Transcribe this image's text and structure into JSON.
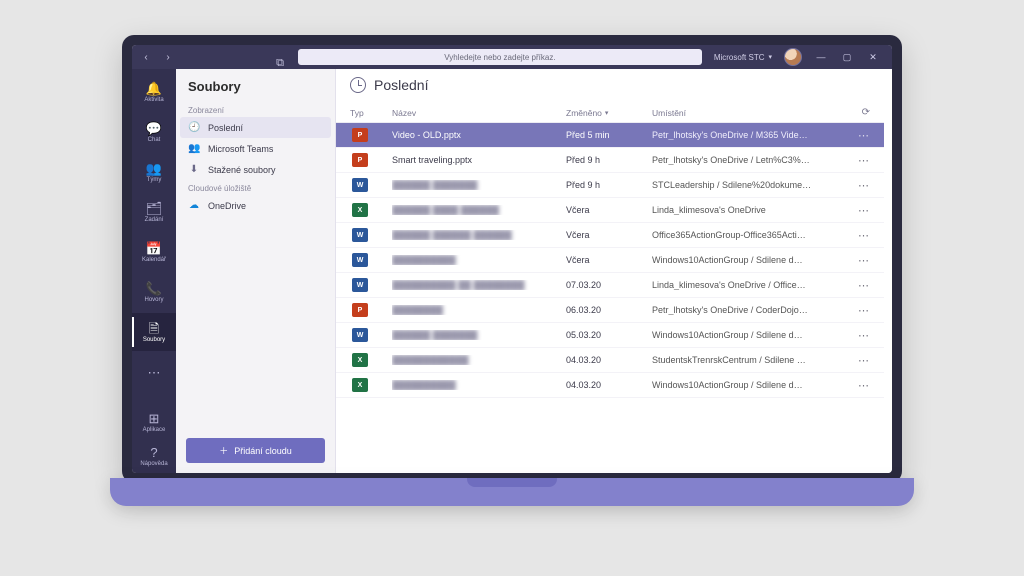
{
  "titlebar": {
    "search_placeholder": "Vyhledejte nebo zadejte příkaz.",
    "org_label": "Microsoft STC"
  },
  "rail": {
    "items": [
      {
        "id": "activity",
        "label": "Aktivita",
        "icon": "🔔"
      },
      {
        "id": "chat",
        "label": "Chat",
        "icon": "💬"
      },
      {
        "id": "teams",
        "label": "Týmy",
        "icon": "👥"
      },
      {
        "id": "assign",
        "label": "Zadání",
        "icon": "🗂"
      },
      {
        "id": "calendar",
        "label": "Kalendář",
        "icon": "📅"
      },
      {
        "id": "calls",
        "label": "Hovory",
        "icon": "📞"
      },
      {
        "id": "files",
        "label": "Soubory",
        "icon": "🗎"
      }
    ],
    "more": "⋯",
    "apps_label": "Aplikace",
    "help_label": "Nápověda"
  },
  "filesnav": {
    "title": "Soubory",
    "view_label": "Zobrazení",
    "views": [
      {
        "id": "recent",
        "label": "Poslední",
        "icon": "🕘"
      },
      {
        "id": "teams",
        "label": "Microsoft Teams",
        "icon": "👥"
      },
      {
        "id": "downloads",
        "label": "Stažené soubory",
        "icon": "⬇"
      }
    ],
    "cloud_label": "Cloudové úložiště",
    "clouds": [
      {
        "id": "onedrive",
        "label": "OneDrive",
        "icon": "☁"
      }
    ],
    "add_cloud_label": "Přidání cloudu"
  },
  "content": {
    "title": "Poslední",
    "columns": {
      "type": "Typ",
      "name": "Název",
      "changed": "Změněno",
      "location": "Umístění"
    },
    "sort_column": "changed",
    "rows": [
      {
        "ft": "pptx",
        "name": "Video - OLD.pptx",
        "changed": "Před 5 min",
        "location": "Petr_lhotsky's OneDrive / M365 Vide…",
        "selected": true
      },
      {
        "ft": "pptx",
        "name": "Smart traveling.pptx",
        "changed": "Před 9 h",
        "location": "Petr_lhotsky's OneDrive / Letn%C3%…"
      },
      {
        "ft": "docx",
        "name": "██████ ███████",
        "changed": "Před 9 h",
        "location": "STCLeadership / Sdilene%20dokume…",
        "blurred": true
      },
      {
        "ft": "xlsx",
        "name": "██████ ████ ██████",
        "changed": "Včera",
        "location": "Linda_klimesova's OneDrive",
        "blurred": true
      },
      {
        "ft": "docx",
        "name": "██████ ██████ ██████",
        "changed": "Včera",
        "location": "Office365ActionGroup-Office365Acti…",
        "blurred": true
      },
      {
        "ft": "docx",
        "name": "██████████",
        "changed": "Včera",
        "location": "Windows10ActionGroup / Sdilene d…",
        "blurred": true
      },
      {
        "ft": "docx",
        "name": "██████████ ██ ████████",
        "changed": "07.03.20",
        "location": "Linda_klimesova's OneDrive / Office…",
        "blurred": true
      },
      {
        "ft": "pptx",
        "name": "████████",
        "changed": "06.03.20",
        "location": "Petr_lhotsky's OneDrive / CoderDojo…",
        "blurred": true
      },
      {
        "ft": "docx",
        "name": "██████ ███████",
        "changed": "05.03.20",
        "location": "Windows10ActionGroup / Sdilene d…",
        "blurred": true
      },
      {
        "ft": "xlsx",
        "name": "████████████",
        "changed": "04.03.20",
        "location": "StudentskTrenrskCentrum / Sdilene …",
        "blurred": true
      },
      {
        "ft": "xlsx",
        "name": "██████████",
        "changed": "04.03.20",
        "location": "Windows10ActionGroup / Sdilene d…",
        "blurred": true
      }
    ]
  }
}
